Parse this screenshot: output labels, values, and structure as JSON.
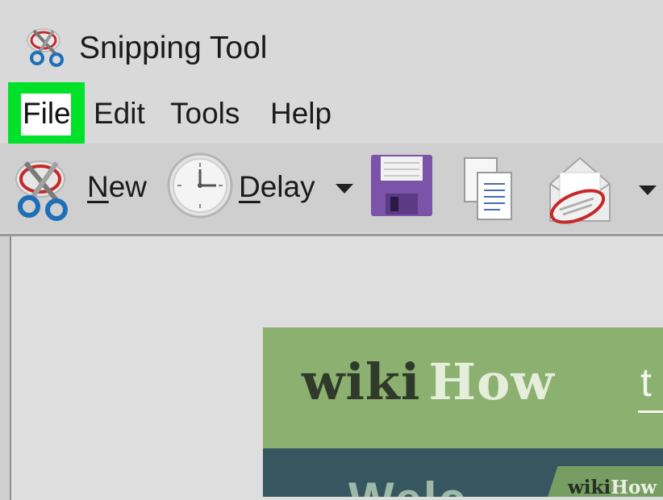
{
  "window": {
    "title": "Snipping Tool",
    "icon": "scissors-icon"
  },
  "menu": {
    "items": [
      {
        "label": "File",
        "highlighted": true
      },
      {
        "label": "Edit"
      },
      {
        "label": "Tools"
      },
      {
        "label": "Help"
      }
    ],
    "highlight_color": "#00e22a"
  },
  "toolbar": {
    "new_label": "ew",
    "new_mnemonic": "N",
    "new_icon": "scissors-icon",
    "delay_label": "elay",
    "delay_mnemonic": "D",
    "delay_icon": "clock-icon",
    "save_icon": "floppy-disk-icon",
    "copy_icon": "copy-icon",
    "send_icon": "envelope-icon"
  },
  "snippet": {
    "brand_wiki": "wiki",
    "brand_how": "How",
    "trailing_text": "t",
    "lower_text": "Welc",
    "badge_wiki": "wiki",
    "badge_how": "How",
    "colors": {
      "header_green": "#8cb070",
      "lower_teal": "#36575f"
    }
  }
}
